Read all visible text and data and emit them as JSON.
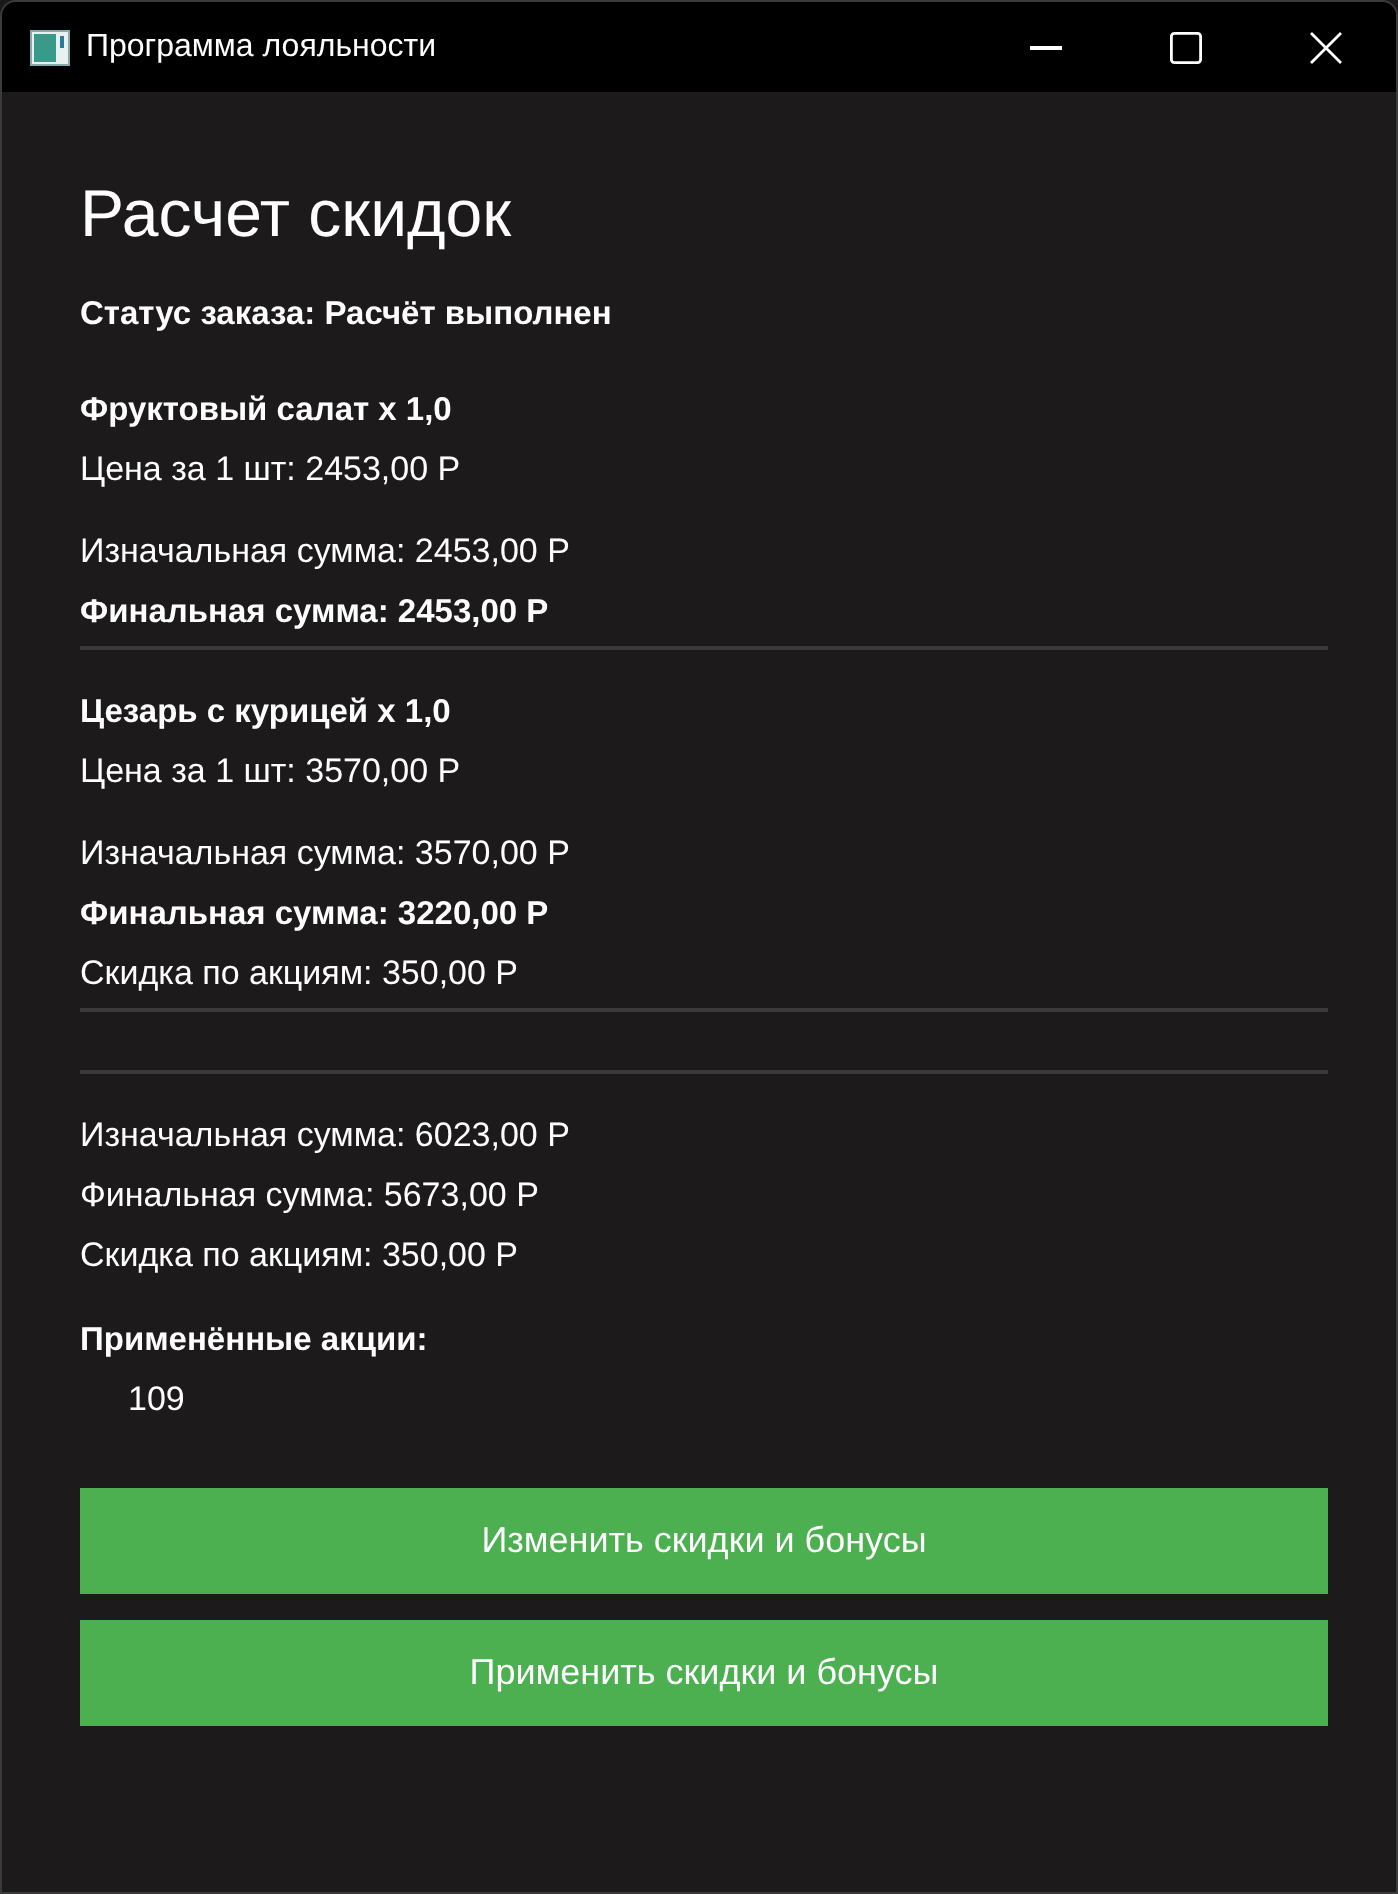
{
  "window": {
    "title": "Программа лояльности"
  },
  "heading": "Расчет скидок",
  "status": "Статус заказа: Расчёт выполнен",
  "items": [
    {
      "name": "Фруктовый салат x 1,0",
      "lines": [
        {
          "kind": "unit_price",
          "text": "Цена за 1 шт: 2453,00 Р",
          "bold": false
        },
        {
          "kind": "sum",
          "text": "Изначальная сумма: 2453,00 Р",
          "bold": false
        },
        {
          "kind": "sum",
          "text": "Финальная сумма: 2453,00 Р",
          "bold": true
        }
      ]
    },
    {
      "name": "Цезарь с курицей x 1,0",
      "lines": [
        {
          "kind": "unit_price",
          "text": "Цена за 1 шт: 3570,00 Р",
          "bold": false
        },
        {
          "kind": "sum",
          "text": "Изначальная сумма: 3570,00 Р",
          "bold": false
        },
        {
          "kind": "sum",
          "text": "Финальная сумма: 3220,00 Р",
          "bold": true
        },
        {
          "kind": "sum",
          "text": "Скидка по акциям: 350,00 Р",
          "bold": false
        }
      ]
    }
  ],
  "totals": [
    {
      "text": "Изначальная сумма: 6023,00 Р",
      "bold": false
    },
    {
      "text": "Финальная сумма: 5673,00 Р",
      "bold": false
    },
    {
      "text": "Скидка по акциям: 350,00 Р",
      "bold": false
    }
  ],
  "applied_promotions": {
    "heading": "Применённые акции:",
    "items": [
      "109"
    ]
  },
  "buttons": [
    "Изменить скидки и бонусы",
    "Применить скидки и бонусы"
  ]
}
